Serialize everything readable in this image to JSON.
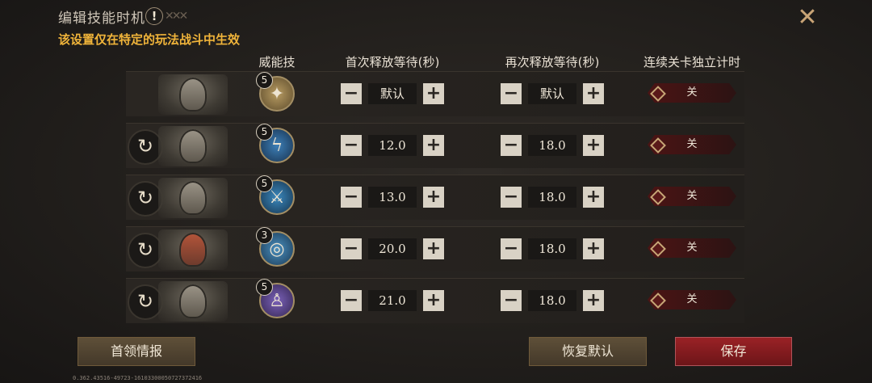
{
  "header": {
    "title": "编辑技能时机",
    "subtitle": "该设置仅在特定的玩法战斗中生效",
    "close_icon": "close-x-icon",
    "warning_icon": "exclamation-icon"
  },
  "columns": {
    "skill": "威能技",
    "first_wait": "首次释放等待(秒)",
    "repeat_wait": "再次释放等待(秒)",
    "independent_timer": "连续关卡独立计时"
  },
  "rows": [
    {
      "has_reset": false,
      "skill_level": "5",
      "skill_icon": "golden-skill-icon",
      "first": "默认",
      "repeat": "默认",
      "toggle": "关"
    },
    {
      "has_reset": true,
      "skill_level": "5",
      "skill_icon": "lightning-skill-icon",
      "first": "12.0",
      "repeat": "18.0",
      "toggle": "关"
    },
    {
      "has_reset": true,
      "skill_level": "5",
      "skill_icon": "ice-spear-skill-icon",
      "first": "13.0",
      "repeat": "18.0",
      "toggle": "关"
    },
    {
      "has_reset": true,
      "skill_level": "3",
      "skill_icon": "sphere-skill-icon",
      "first": "20.0",
      "repeat": "18.0",
      "toggle": "关"
    },
    {
      "has_reset": true,
      "skill_level": "5",
      "skill_icon": "purple-figure-skill-icon",
      "first": "21.0",
      "repeat": "18.0",
      "toggle": "关"
    }
  ],
  "buttons": {
    "boss_info": "首领情报",
    "restore_default": "恢复默认",
    "save": "保存"
  },
  "version": "0.362.43516-49723-16103300050727372416",
  "colors": {
    "accent_gold": "#f0b43a",
    "save_red": "#9b2226",
    "brown_button": "#5f5039"
  }
}
